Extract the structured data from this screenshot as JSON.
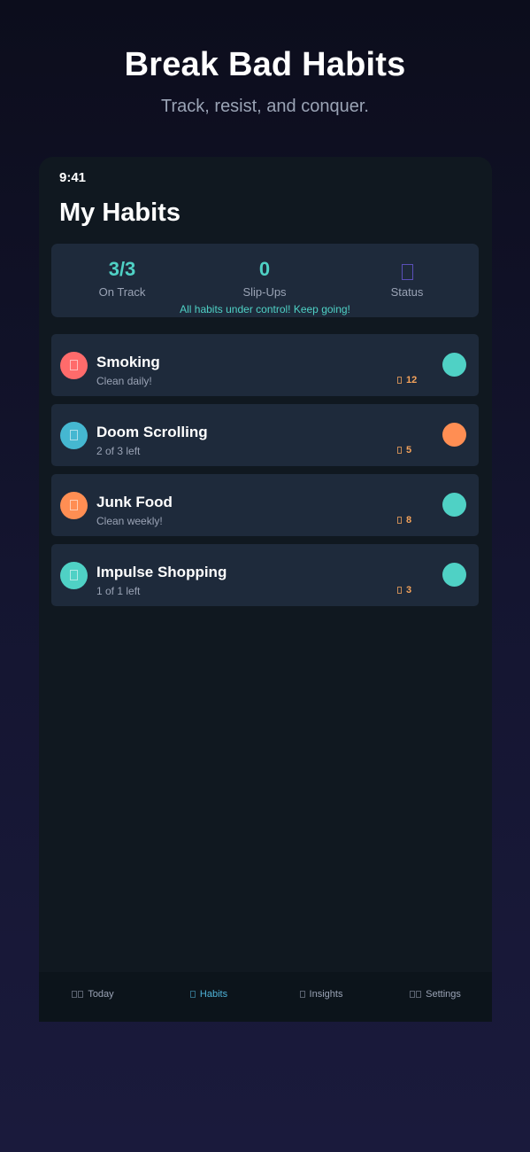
{
  "hero": {
    "title": "Break Bad Habits",
    "subtitle": "Track, resist, and conquer."
  },
  "status_bar": {
    "time": "9:41"
  },
  "page": {
    "title": "My Habits"
  },
  "summary": {
    "stats": [
      {
        "value": "3/3",
        "label": "On Track"
      },
      {
        "value": "0",
        "label": "Slip-Ups"
      },
      {
        "value": "",
        "label": "Status",
        "icon": "status-icon"
      }
    ],
    "message": "All habits under control! Keep going!"
  },
  "habits": [
    {
      "name": "Smoking",
      "subtitle": "Clean daily!",
      "streak": "12",
      "icon_color": "#ff6b6b",
      "toggle_color": "#4fd1c5",
      "icon": "smoking-icon"
    },
    {
      "name": "Doom Scrolling",
      "subtitle": "2 of 3 left",
      "streak": "5",
      "icon_color": "#45b7d1",
      "toggle_color": "#ff8e53",
      "icon": "phone-icon"
    },
    {
      "name": "Junk Food",
      "subtitle": "Clean weekly!",
      "streak": "8",
      "icon_color": "#ff8e53",
      "toggle_color": "#4fd1c5",
      "icon": "food-icon"
    },
    {
      "name": "Impulse Shopping",
      "subtitle": "1 of 1 left",
      "streak": "3",
      "icon_color": "#4fd1c5",
      "toggle_color": "#4fd1c5",
      "icon": "shopping-icon"
    }
  ],
  "tabs": [
    {
      "label": "Today",
      "active": false,
      "icon": "calendar-icon"
    },
    {
      "label": "Habits",
      "active": true,
      "icon": "list-icon"
    },
    {
      "label": "Insights",
      "active": false,
      "icon": "chart-icon"
    },
    {
      "label": "Settings",
      "active": false,
      "icon": "gear-icon"
    }
  ],
  "colors": {
    "accent": "#4fd1c5",
    "active_tab": "#4fb3d9",
    "streak": "#f6a35b",
    "card": "#1e2a3b",
    "phone_bg": "#101820"
  }
}
